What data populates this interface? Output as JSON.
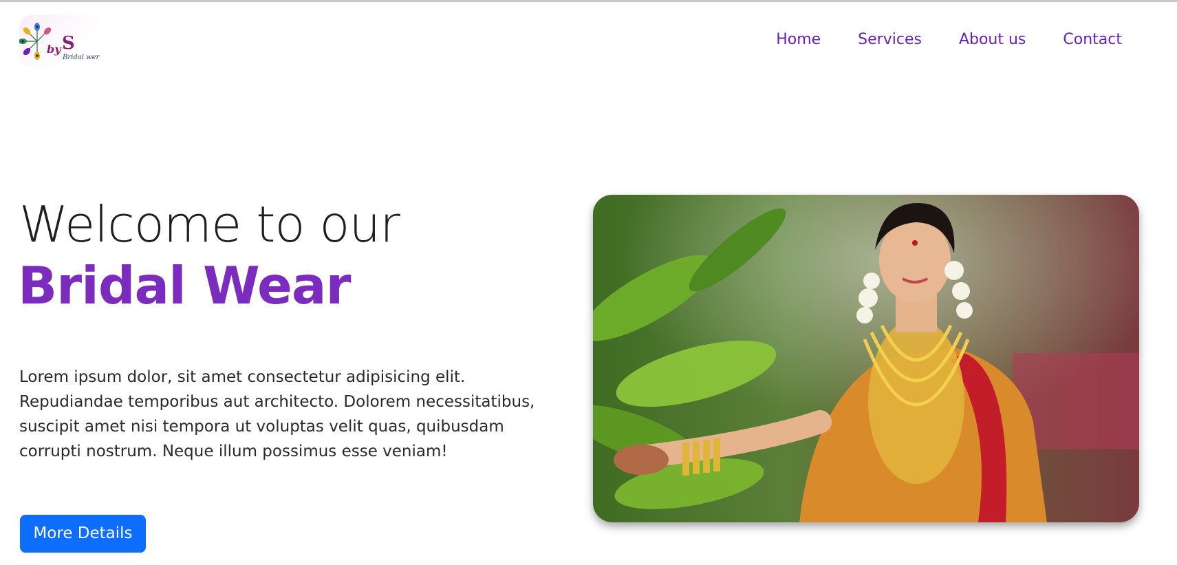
{
  "brand": {
    "logo_by": "by",
    "logo_s": "S",
    "logo_sub": "Bridal wer"
  },
  "nav": {
    "items": [
      {
        "label": "Home"
      },
      {
        "label": "Services"
      },
      {
        "label": "About us"
      },
      {
        "label": "Contact"
      }
    ]
  },
  "hero": {
    "line1": "Welcome to our",
    "line2": "Bridal Wear",
    "paragraph": "Lorem ipsum dolor, sit amet consectetur adipisicing elit. Repudiandae temporibus aut architecto. Dolorem necessitatibus, suscipit amet nisi tempora ut voluptas velit quas, quibusdam corrupti nostrum. Neque illum possimus esse veniam!",
    "button_label": "More Details"
  },
  "colors": {
    "accent": "#7b2cbf",
    "nav_link": "#6a1fb8",
    "button": "#0d6efd"
  }
}
